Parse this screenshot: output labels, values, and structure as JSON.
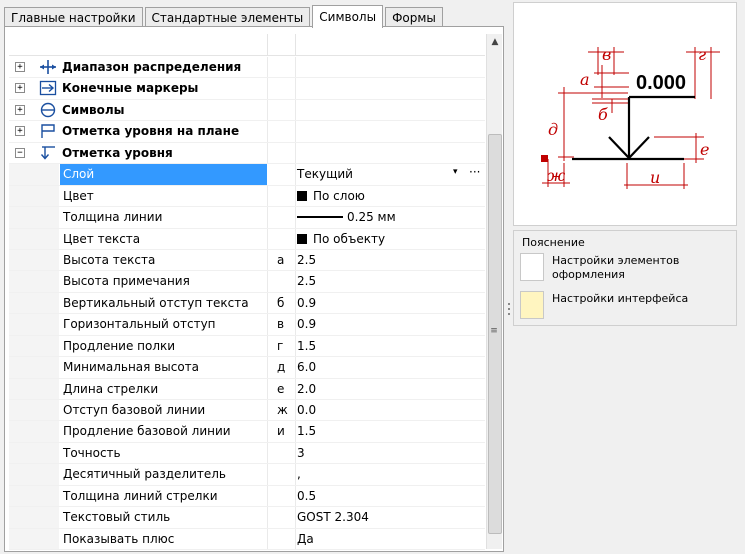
{
  "tabs": [
    {
      "label": "Главные настройки",
      "active": false
    },
    {
      "label": "Стандартные элементы",
      "active": false
    },
    {
      "label": "Символы",
      "active": true
    },
    {
      "label": "Формы",
      "active": false
    }
  ],
  "categories": [
    {
      "label": "Диапазон распределения",
      "expander": "+",
      "icon": "distribution-range-icon"
    },
    {
      "label": "Конечные маркеры",
      "expander": "+",
      "icon": "end-marker-icon"
    },
    {
      "label": "Символы",
      "expander": "+",
      "icon": "symbol-circle-icon"
    },
    {
      "label": "Отметка уровня на плане",
      "expander": "+",
      "icon": "plan-level-mark-icon"
    },
    {
      "label": "Отметка уровня",
      "expander": "−",
      "icon": "level-mark-icon"
    }
  ],
  "properties": [
    {
      "label": "Слой",
      "letter": "",
      "value": "Текущий"
    },
    {
      "label": "Цвет",
      "letter": "",
      "value": "По слою"
    },
    {
      "label": "Толщина линии",
      "letter": "",
      "value": "0.25 мм"
    },
    {
      "label": "Цвет текста",
      "letter": "",
      "value": "По объекту"
    },
    {
      "label": "Высота текста",
      "letter": "а",
      "value": "2.5"
    },
    {
      "label": "Высота примечания",
      "letter": "",
      "value": "2.5"
    },
    {
      "label": "Вертикальный отступ текста",
      "letter": "б",
      "value": "0.9"
    },
    {
      "label": "Горизонтальный отступ",
      "letter": "в",
      "value": "0.9"
    },
    {
      "label": "Продление полки",
      "letter": "г",
      "value": "1.5"
    },
    {
      "label": "Минимальная высота",
      "letter": "д",
      "value": "6.0"
    },
    {
      "label": "Длина стрелки",
      "letter": "е",
      "value": "2.0"
    },
    {
      "label": "Отступ базовой линии",
      "letter": "ж",
      "value": "0.0"
    },
    {
      "label": "Продление базовой линии",
      "letter": "и",
      "value": "1.5"
    },
    {
      "label": "Точность",
      "letter": "",
      "value": "3"
    },
    {
      "label": "Десятичный разделитель",
      "letter": "",
      "value": ","
    },
    {
      "label": "Толщина линий стрелки",
      "letter": "",
      "value": "0.5"
    },
    {
      "label": "Текстовый стиль",
      "letter": "",
      "value": "GOST 2.304"
    },
    {
      "label": "Показывать плюс",
      "letter": "",
      "value": "Да"
    }
  ],
  "dropdown": {
    "arrow": "▾",
    "dots": "···"
  },
  "scrollbar": {
    "up": "▲",
    "grip": "≡"
  },
  "preview": {
    "level_text": "0.000",
    "dim_letters": [
      "а",
      "б",
      "в",
      "г",
      "д",
      "е",
      "ж",
      "и"
    ]
  },
  "legend": {
    "title": "Пояснение",
    "items": [
      {
        "label": "Настройки элементов оформления",
        "color": "#ffffff"
      },
      {
        "label": "Настройки интерфейса",
        "color": "#fff5c0"
      }
    ]
  },
  "colors": {
    "selection": "#3399ff",
    "dimension": "#c00000"
  }
}
